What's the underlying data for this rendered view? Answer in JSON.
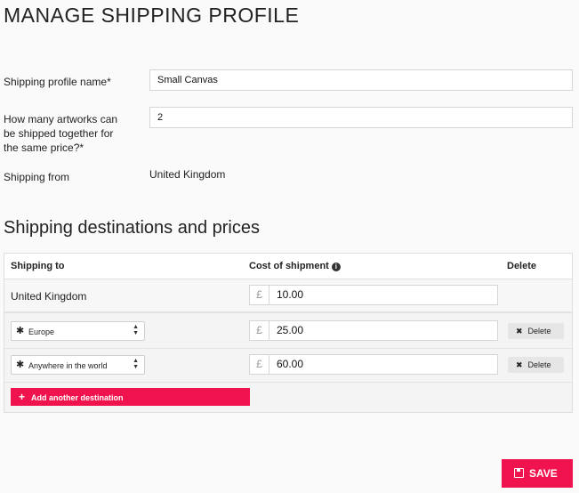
{
  "page": {
    "title": "MANAGE SHIPPING PROFILE"
  },
  "form": {
    "profile_name_label": "Shipping profile name*",
    "profile_name_value": "Small Canvas",
    "artworks_label_line1": "How many artworks can",
    "artworks_label_line2": "be shipped together for",
    "artworks_label_line3": "the same price?*",
    "artworks_value": "2",
    "shipping_from_label": "Shipping from",
    "shipping_from_value": "United Kingdom"
  },
  "destinations": {
    "section_title": "Shipping destinations and prices",
    "headers": {
      "shipping_to": "Shipping to",
      "cost": "Cost of shipment",
      "delete": "Delete"
    },
    "currency_symbol": "£",
    "rows": [
      {
        "destination": "United Kingdom",
        "price": "10.00"
      },
      {
        "destination": "Europe",
        "price": "25.00",
        "delete_label": "Delete"
      },
      {
        "destination": "Anywhere in the world",
        "price": "60.00",
        "delete_label": "Delete"
      }
    ],
    "add_label": "Add another destination"
  },
  "actions": {
    "save_label": "SAVE"
  },
  "colors": {
    "accent": "#f0134d"
  }
}
